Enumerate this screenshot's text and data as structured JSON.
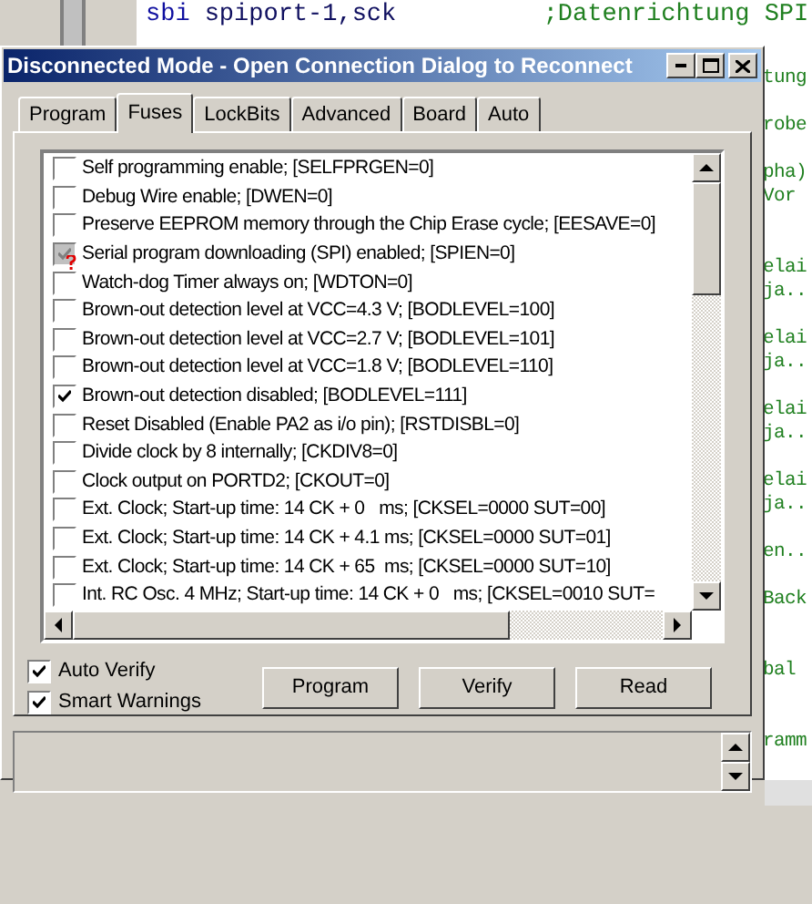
{
  "editor": {
    "lines": [
      {
        "keyword": "sbi",
        "operand": "spiport-1,sck",
        "comment": ";Datenrichtung SPI"
      }
    ],
    "side_fragments": [
      "tung",
      "robe",
      "pha)",
      "Vor",
      "elai",
      "ja..",
      "elai",
      "ja..",
      "elai",
      "ja..",
      "elai",
      "ja..",
      "en..",
      "Back",
      "bal",
      "ramm"
    ]
  },
  "dialog": {
    "title": "Disconnected Mode - Open Connection Dialog to Reconnect",
    "tabs": [
      {
        "label": "Program",
        "selected": false
      },
      {
        "label": "Fuses",
        "selected": true
      },
      {
        "label": "LockBits",
        "selected": false
      },
      {
        "label": "Advanced",
        "selected": false
      },
      {
        "label": "Board",
        "selected": false
      },
      {
        "label": "Auto",
        "selected": false
      }
    ],
    "fuses": [
      {
        "label": "Self programming enable; [SELFPRGEN=0]",
        "checked": false,
        "disabled": false
      },
      {
        "label": "Debug Wire enable; [DWEN=0]",
        "checked": false,
        "disabled": false
      },
      {
        "label": "Preserve EEPROM memory through the Chip Erase cycle; [EESAVE=0]",
        "checked": false,
        "disabled": false
      },
      {
        "label": "Serial program downloading (SPI) enabled; [SPIEN=0]",
        "checked": true,
        "disabled": true
      },
      {
        "label": "Watch-dog Timer always on; [WDTON=0]",
        "checked": false,
        "disabled": false
      },
      {
        "label": "Brown-out detection level at VCC=4.3 V; [BODLEVEL=100]",
        "checked": false,
        "disabled": false
      },
      {
        "label": "Brown-out detection level at VCC=2.7 V; [BODLEVEL=101]",
        "checked": false,
        "disabled": false
      },
      {
        "label": "Brown-out detection level at VCC=1.8 V; [BODLEVEL=110]",
        "checked": false,
        "disabled": false
      },
      {
        "label": "Brown-out detection disabled; [BODLEVEL=111]",
        "checked": true,
        "disabled": false
      },
      {
        "label": "Reset Disabled (Enable PA2 as i/o pin); [RSTDISBL=0]",
        "checked": false,
        "disabled": false
      },
      {
        "label": "Divide clock by 8 internally; [CKDIV8=0]",
        "checked": false,
        "disabled": false
      },
      {
        "label": "Clock output on PORTD2; [CKOUT=0]",
        "checked": false,
        "disabled": false
      },
      {
        "label": "Ext. Clock; Start-up time: 14 CK + 0   ms; [CKSEL=0000 SUT=00]",
        "checked": false,
        "disabled": false
      },
      {
        "label": "Ext. Clock; Start-up time: 14 CK + 4.1 ms; [CKSEL=0000 SUT=01]",
        "checked": false,
        "disabled": false
      },
      {
        "label": "Ext. Clock; Start-up time: 14 CK + 65  ms; [CKSEL=0000 SUT=10]",
        "checked": false,
        "disabled": false
      },
      {
        "label": "Int. RC Osc. 4 MHz; Start-up time: 14 CK + 0   ms; [CKSEL=0010 SUT=",
        "checked": false,
        "disabled": false
      }
    ],
    "options": [
      {
        "label": "Auto Verify",
        "checked": true
      },
      {
        "label": "Smart Warnings",
        "checked": true
      }
    ],
    "buttons": [
      "Program",
      "Verify",
      "Read"
    ]
  }
}
